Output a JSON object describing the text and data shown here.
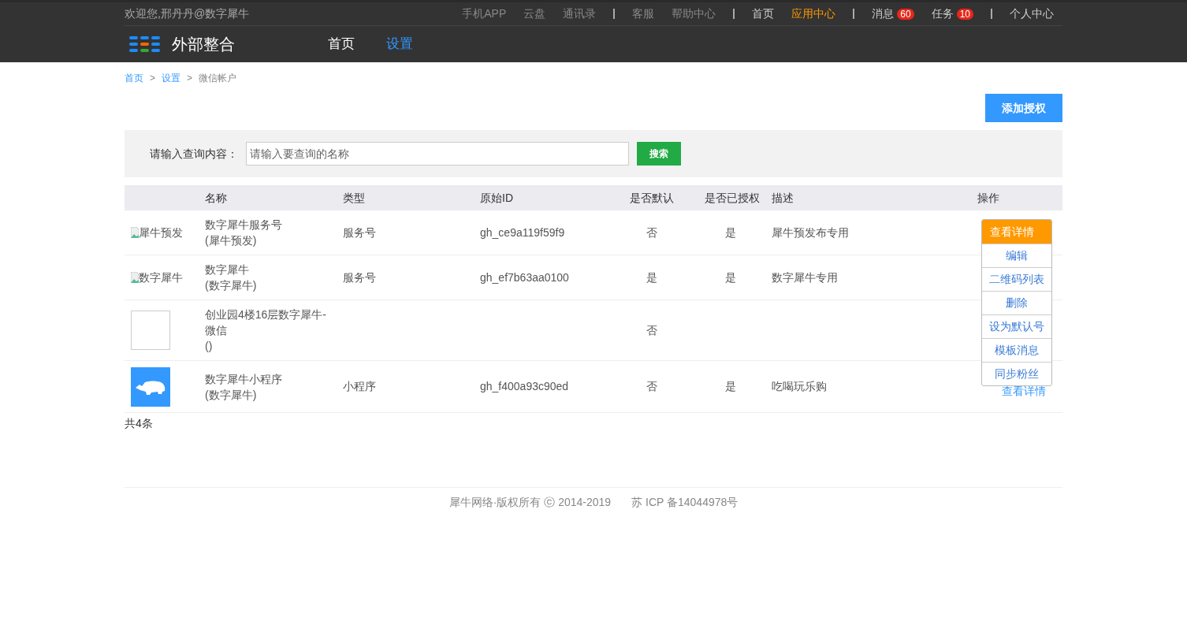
{
  "topbar": {
    "welcome": "欢迎您,邢丹丹@数字犀牛",
    "links": [
      {
        "label": "手机APP",
        "kind": "muted"
      },
      {
        "label": "云盘",
        "kind": "muted"
      },
      {
        "label": "通讯录",
        "kind": "muted"
      },
      {
        "kind": "sep"
      },
      {
        "label": "客服",
        "kind": "muted"
      },
      {
        "label": "帮助中心",
        "kind": "muted"
      },
      {
        "kind": "sep"
      },
      {
        "label": "首页",
        "kind": "link"
      },
      {
        "label": "应用中心",
        "kind": "active"
      },
      {
        "kind": "sep"
      },
      {
        "label": "消息",
        "kind": "link",
        "badge": "60"
      },
      {
        "label": "任务",
        "kind": "link",
        "badge": "10"
      },
      {
        "kind": "sep"
      },
      {
        "label": "个人中心",
        "kind": "link"
      }
    ]
  },
  "header": {
    "app_name": "外部整合",
    "nav": [
      {
        "label": "首页",
        "selected": false
      },
      {
        "label": "设置",
        "selected": true
      }
    ]
  },
  "breadcrumb": [
    {
      "label": "首页",
      "current": false
    },
    {
      "label": ">",
      "kind": "sep"
    },
    {
      "label": "设置",
      "current": false
    },
    {
      "label": ">",
      "kind": "sep"
    },
    {
      "label": "微信帐户",
      "current": true
    }
  ],
  "add_button": "添加授权",
  "search": {
    "label": "请输入查询内容：",
    "placeholder": "请输入要查询的名称",
    "button": "搜索"
  },
  "table": {
    "columns": [
      "名称",
      "类型",
      "原始ID",
      "是否默认",
      "是否已授权",
      "描述",
      "操作"
    ],
    "rows": [
      {
        "image": {
          "kind": "broken",
          "alt": "犀牛预发"
        },
        "name": "数字犀牛服务号",
        "sub": "(犀牛预发)",
        "type": "服务号",
        "id": "gh_ce9a119f59f9",
        "default": "否",
        "authorized": "是",
        "desc": "犀牛预发布专用"
      },
      {
        "image": {
          "kind": "broken",
          "alt": "数字犀牛"
        },
        "name": "数字犀牛",
        "sub": "(数字犀牛)",
        "type": "服务号",
        "id": "gh_ef7b63aa0100",
        "default": "是",
        "authorized": "是",
        "desc": "数字犀牛专用"
      },
      {
        "image": {
          "kind": "blank"
        },
        "name": "创业园4楼16层数字犀牛-微信",
        "sub": "()",
        "default": "否"
      },
      {
        "image": {
          "kind": "logo"
        },
        "name": "数字犀牛小程序",
        "sub": "(数字犀牛)",
        "type": "小程序",
        "id": "gh_f400a93c90ed",
        "default": "否",
        "authorized": "是",
        "desc": "吃喝玩乐购",
        "action": "查看详情"
      }
    ]
  },
  "menu": [
    {
      "label": "查看详情",
      "selected": true
    },
    {
      "label": "编辑",
      "selected": false
    },
    {
      "label": "二维码列表",
      "selected": false
    },
    {
      "label": "删除",
      "selected": false
    },
    {
      "label": "设为默认号",
      "selected": false
    },
    {
      "label": "模板消息",
      "selected": false
    },
    {
      "label": "同步粉丝",
      "selected": false
    }
  ],
  "total": "共4条",
  "footer": {
    "copyright": "犀牛网络·版权所有 ⓒ 2014-2019",
    "icp": "苏 ICP 备14044978号"
  }
}
